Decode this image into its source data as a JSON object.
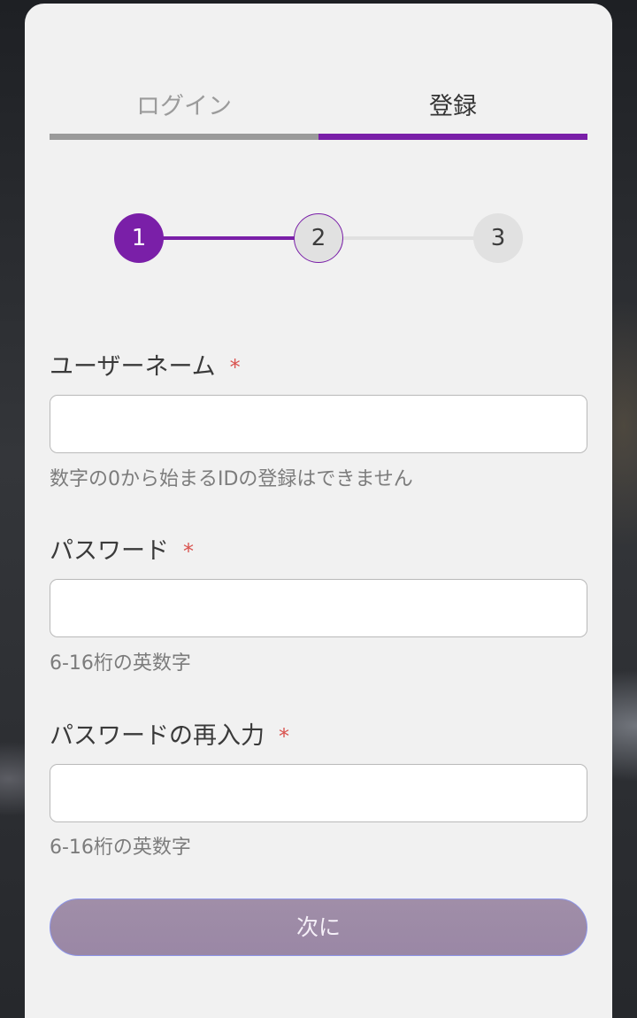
{
  "tabs": {
    "login_label": "ログイン",
    "register_label": "登録",
    "active": "register"
  },
  "stepper": {
    "steps": [
      "1",
      "2",
      "3"
    ],
    "current_step": 2
  },
  "form": {
    "username": {
      "label": "ユーザーネーム",
      "required_mark": "*",
      "value": "",
      "hint": "数字の0から始まるIDの登録はできません"
    },
    "password": {
      "label": "パスワード",
      "required_mark": "*",
      "value": "",
      "hint": "6-16桁の英数字"
    },
    "password_confirm": {
      "label": "パスワードの再入力",
      "required_mark": "*",
      "value": "",
      "hint": "6-16桁の英数字"
    }
  },
  "next_button": {
    "label": "次に"
  },
  "colors": {
    "accent": "#7a1fa8",
    "required": "#d9534f",
    "button_bg": "#9e8ba7"
  }
}
